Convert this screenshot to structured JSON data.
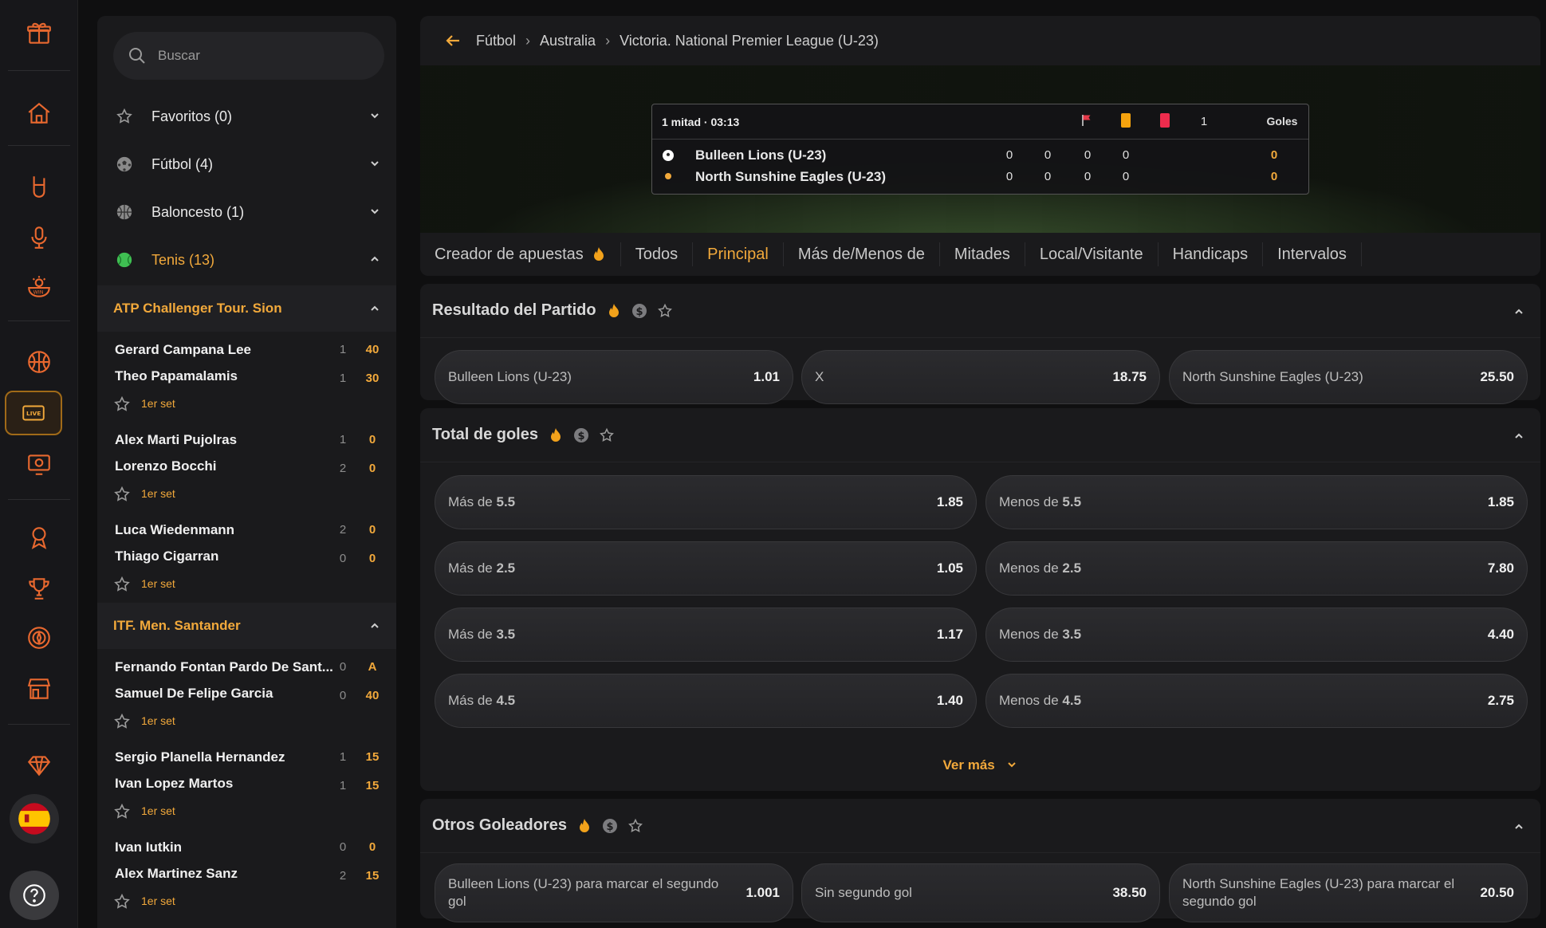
{
  "search": {
    "placeholder": "Buscar"
  },
  "sidebar": {
    "categories": [
      {
        "label": "Favoritos (0)",
        "icon": "star-icon"
      },
      {
        "label": "Fútbol (4)",
        "icon": "soccer-ball-icon"
      },
      {
        "label": "Baloncesto (1)",
        "icon": "basketball-icon"
      },
      {
        "label": "Tenis (13)",
        "icon": "tennis-ball-icon"
      }
    ],
    "leagues": [
      {
        "name": "ATP Challenger Tour. Sion",
        "matches": [
          {
            "p1": "Gerard Campana Lee",
            "s1": "1",
            "g1": "40",
            "p2": "Theo Papamalamis",
            "s2": "1",
            "g2": "30",
            "period": "1er set"
          },
          {
            "p1": "Alex Marti Pujolras",
            "s1": "1",
            "g1": "0",
            "p2": "Lorenzo Bocchi",
            "s2": "2",
            "g2": "0",
            "period": "1er set"
          },
          {
            "p1": "Luca Wiedenmann",
            "s1": "2",
            "g1": "0",
            "p2": "Thiago Cigarran",
            "s2": "0",
            "g2": "0",
            "period": "1er set"
          }
        ]
      },
      {
        "name": "ITF. Men. Santander",
        "matches": [
          {
            "p1": "Fernando Fontan Pardo De Sant...",
            "s1": "0",
            "g1": "A",
            "p2": "Samuel De Felipe Garcia",
            "s2": "0",
            "g2": "40",
            "period": "1er set"
          },
          {
            "p1": "Sergio Planella Hernandez",
            "s1": "1",
            "g1": "15",
            "p2": "Ivan Lopez Martos",
            "s2": "1",
            "g2": "15",
            "period": "1er set"
          },
          {
            "p1": "Ivan Iutkin",
            "s1": "0",
            "g1": "0",
            "p2": "Alex Martinez Sanz",
            "s2": "2",
            "g2": "15",
            "period": "1er set"
          }
        ]
      }
    ]
  },
  "breadcrumb": {
    "items": [
      "Fútbol",
      "Australia",
      "Victoria. National Premier League (U-23)"
    ]
  },
  "scoreboard": {
    "time": "1 mitad · 03:13",
    "col_penalty": "1",
    "col_goals": "Goles",
    "teams": [
      {
        "name": "Bulleen Lions (U-23)",
        "corners": "0",
        "yellow": "0",
        "red": "0",
        "penalty": "0",
        "goals": "0"
      },
      {
        "name": "North Sunshine Eagles (U-23)",
        "corners": "0",
        "yellow": "0",
        "red": "0",
        "penalty": "0",
        "goals": "0"
      }
    ]
  },
  "tabs": [
    "Creador de apuestas",
    "Todos",
    "Principal",
    "Más de/Menos de",
    "Mitades",
    "Local/Visitante",
    "Handicaps",
    "Intervalos"
  ],
  "active_tab": "Principal",
  "markets": {
    "result": {
      "title": "Resultado del Partido",
      "odds": [
        {
          "label": "Bulleen Lions (U-23)",
          "value": "1.01"
        },
        {
          "label": "X",
          "value": "18.75"
        },
        {
          "label": "North Sunshine Eagles (U-23)",
          "value": "25.50"
        }
      ]
    },
    "total": {
      "title": "Total de goles",
      "rows": [
        {
          "over_prefix": "Más de",
          "over_line": "5.5",
          "over_value": "1.85",
          "under_prefix": "Menos de",
          "under_line": "5.5",
          "under_value": "1.85"
        },
        {
          "over_prefix": "Más de",
          "over_line": "2.5",
          "over_value": "1.05",
          "under_prefix": "Menos de",
          "under_line": "2.5",
          "under_value": "7.80"
        },
        {
          "over_prefix": "Más de",
          "over_line": "3.5",
          "over_value": "1.17",
          "under_prefix": "Menos de",
          "under_line": "3.5",
          "under_value": "4.40"
        },
        {
          "over_prefix": "Más de",
          "over_line": "4.5",
          "over_value": "1.40",
          "under_prefix": "Menos de",
          "under_line": "4.5",
          "under_value": "2.75"
        }
      ],
      "more": "Ver más"
    },
    "scorers": {
      "title": "Otros Goleadores",
      "odds": [
        {
          "label": "Bulleen Lions (U-23) para marcar el segundo gol",
          "value": "1.001"
        },
        {
          "label": "Sin segundo gol",
          "value": "38.50"
        },
        {
          "label": "North Sunshine Eagles (U-23) para marcar el segundo gol",
          "value": "20.50"
        }
      ]
    }
  },
  "colors": {
    "accent": "#f2a93b",
    "background": "#0f0f10",
    "panel": "#1a1a1c"
  }
}
